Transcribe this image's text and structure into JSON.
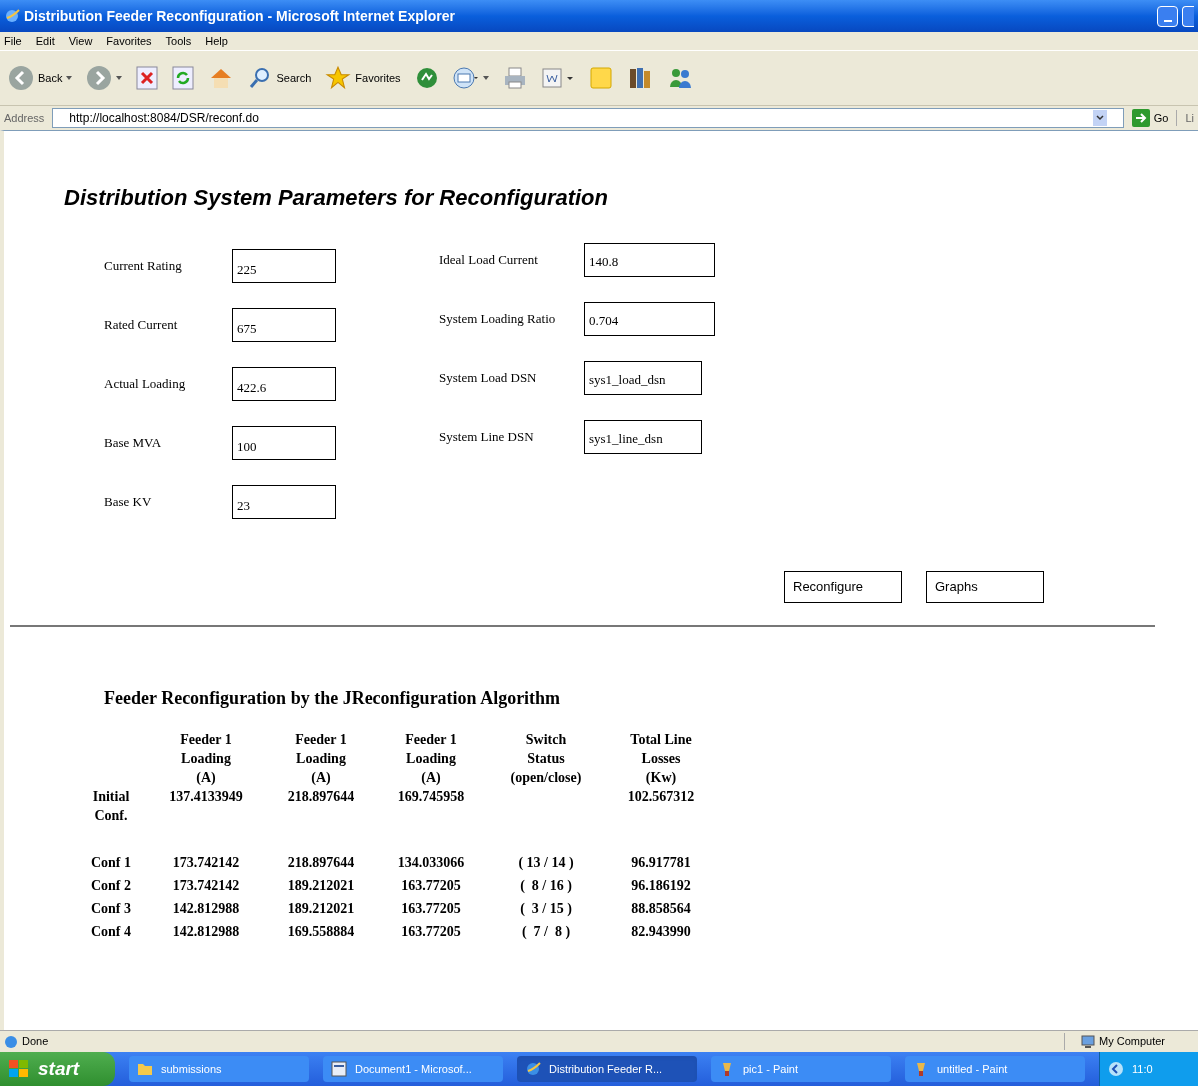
{
  "window": {
    "title": "Distribution Feeder Reconfiguration - Microsoft Internet Explorer"
  },
  "menu": [
    "File",
    "Edit",
    "View",
    "Favorites",
    "Tools",
    "Help"
  ],
  "toolbar": [
    {
      "kind": "back",
      "label": "Back"
    },
    {
      "kind": "forward"
    },
    {
      "kind": "stop"
    },
    {
      "kind": "refresh"
    },
    {
      "kind": "home"
    },
    {
      "kind": "search",
      "label": "Search"
    },
    {
      "kind": "favorites",
      "label": "Favorites"
    },
    {
      "kind": "media"
    },
    {
      "kind": "mail"
    },
    {
      "kind": "print"
    },
    {
      "kind": "edit"
    },
    {
      "kind": "note"
    },
    {
      "kind": "research"
    },
    {
      "kind": "messenger"
    }
  ],
  "address": {
    "label": "Address",
    "url": "http://localhost:8084/DSR/reconf.do",
    "go": "Go",
    "links": "Li"
  },
  "page": {
    "heading": "Distribution System Parameters for Reconfiguration",
    "left_fields": [
      {
        "label": "Current Rating",
        "value": "225"
      },
      {
        "label": "Rated Current",
        "value": "675"
      },
      {
        "label": "Actual Loading",
        "value": "422.6"
      },
      {
        "label": "Base MVA",
        "value": "100"
      },
      {
        "label": "Base KV",
        "value": "23"
      }
    ],
    "right_fields": [
      {
        "label": "Ideal Load Current",
        "value": "140.8"
      },
      {
        "label": "System Loading Ratio",
        "value": "0.704"
      },
      {
        "label": "System Load DSN",
        "value": "sys1_load_dsn"
      },
      {
        "label": "System Line DSN",
        "value": "sys1_line_dsn"
      }
    ],
    "buttons": [
      "Reconfigure",
      "Graphs"
    ],
    "table": {
      "title": "Feeder Reconfiguration by the JReconfiguration Algorithm",
      "columns": [
        {
          "lines": [
            "Feeder 1",
            "Loading",
            "(A)"
          ]
        },
        {
          "lines": [
            "Feeder 1",
            "Loading",
            "(A)"
          ]
        },
        {
          "lines": [
            "Feeder 1",
            "Loading",
            "(A)"
          ]
        },
        {
          "lines": [
            "Switch",
            "Status",
            "(open/close)"
          ]
        },
        {
          "lines": [
            "Total Line",
            "Losses",
            "(Kw)"
          ]
        }
      ],
      "rows": [
        {
          "label": [
            "Initial",
            "Conf."
          ],
          "cells": [
            "137.4133949",
            "218.897644",
            "169.745958",
            null,
            "102.567312"
          ]
        },
        {
          "label": [
            "Conf 1"
          ],
          "cells": [
            "173.742142",
            "218.897644",
            "134.033066",
            "( 13 / 14 )",
            "96.917781"
          ]
        },
        {
          "label": [
            "Conf 2"
          ],
          "cells": [
            "173.742142",
            "189.212021",
            "163.77205",
            "(  8 / 16 )",
            "96.186192"
          ]
        },
        {
          "label": [
            "Conf 3"
          ],
          "cells": [
            "142.812988",
            "189.212021",
            "163.77205",
            "(  3 / 15 )",
            "88.858564"
          ]
        },
        {
          "label": [
            "Conf 4"
          ],
          "cells": [
            "142.812988",
            "169.558884",
            "163.77205",
            "(  7 /  8 )",
            "82.943990"
          ]
        }
      ]
    }
  },
  "status_bar": {
    "text": "Done",
    "zone": "My Computer"
  },
  "taskbar": {
    "start": "start",
    "items": [
      {
        "label": "submissions",
        "kind": "folder",
        "selected": false
      },
      {
        "label": "Document1 - Microsof...",
        "kind": "word",
        "selected": false
      },
      {
        "label": "Distribution Feeder R...",
        "kind": "ie",
        "selected": true
      },
      {
        "label": "pic1 - Paint",
        "kind": "paint",
        "selected": false
      },
      {
        "label": "untitled - Paint",
        "kind": "paint",
        "selected": false
      }
    ],
    "clock": "11:0"
  }
}
